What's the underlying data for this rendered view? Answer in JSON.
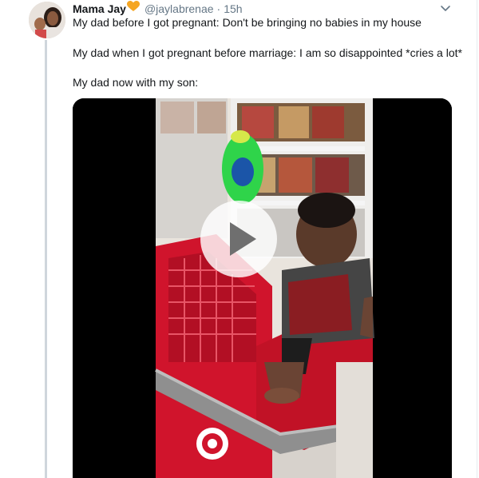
{
  "tweet": {
    "author": {
      "display_name": "Mama Jay",
      "handle": "@jaylabrenae",
      "separator": "·",
      "time": "15h",
      "badge_icon": "heart-icon",
      "badge_color": "#f5a623"
    },
    "text_lines": [
      "My dad before I got pregnant: Don't be bringing no babies in my house",
      "My dad when I got pregnant before marriage: I am so disappointed *cries a lot*",
      "My dad now with my son:"
    ],
    "media": {
      "type": "video",
      "play_icon": "play-icon"
    },
    "menu_icon": "chevron-down-icon"
  },
  "colors": {
    "text": "#14171a",
    "muted": "#657786",
    "thread_line": "#cfd6dc",
    "cart_red": "#d0142c"
  }
}
